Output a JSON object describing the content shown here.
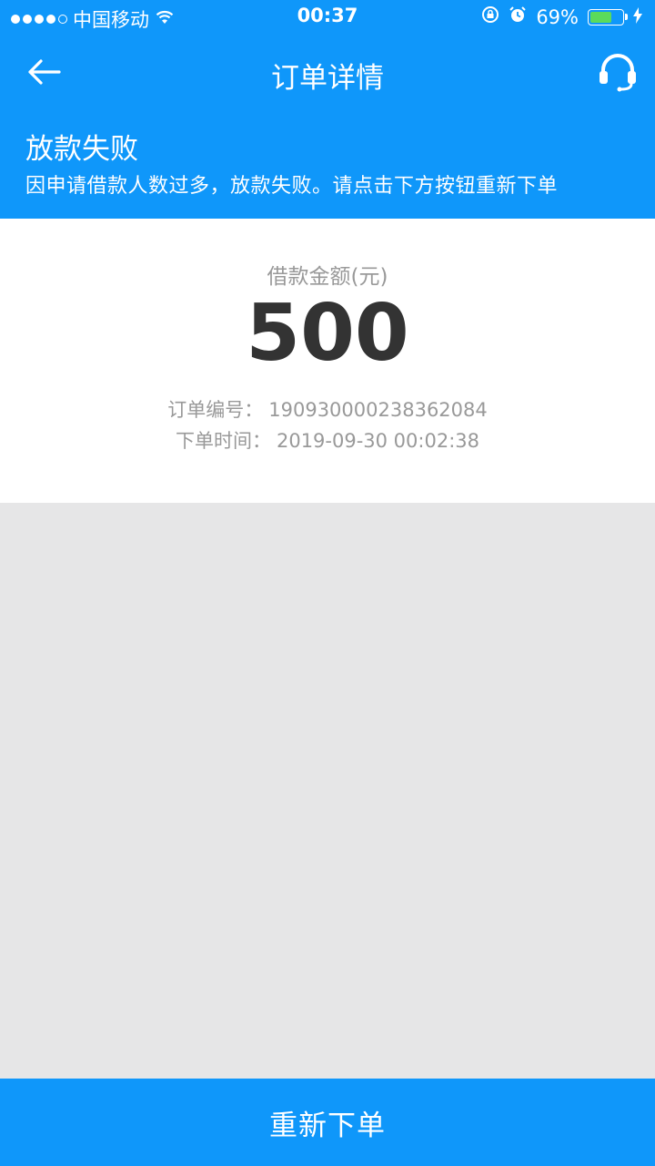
{
  "statusbar": {
    "carrier": "中国移动",
    "time": "00:37",
    "battery": "69%",
    "battery_level": 0.69
  },
  "navbar": {
    "title": "订单详情",
    "back_icon": "arrow-left-icon",
    "service_icon": "headset-icon"
  },
  "order_status": {
    "title": "放款失败",
    "description": "因申请借款人数过多，放款失败。请点击下方按钮重新下单"
  },
  "loan": {
    "amount_label": "借款金额(元)",
    "amount": "500",
    "order_no_label": "订单编号：",
    "order_no": "19093000023836208­4",
    "order_time_label": "下单时间：",
    "order_time": "2019-09-30 00:02:38"
  },
  "actions": {
    "reorder_label": "重新下单"
  },
  "colors": {
    "primary": "#0f97fa",
    "background": "#e6e6e7",
    "text_dark": "#333333",
    "text_gray": "#999999"
  }
}
